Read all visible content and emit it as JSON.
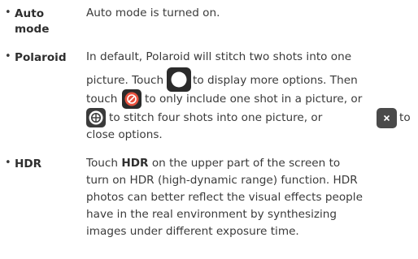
{
  "entries": [
    {
      "term_line1": "Auto",
      "term_line2": "mode",
      "desc": "Auto mode is turned on."
    },
    {
      "term": "Polaroid",
      "line1": "In default, Polaroid will stitch two shots into one",
      "line2_a": "picture. Touch",
      "line2_b": "to display more options. Then",
      "line3_a": "touch",
      "line3_b": "to only include one shot in a picture, or",
      "line4_a": "to stitch four shots into one picture, or",
      "line4_b": "to",
      "line5": "close options."
    },
    {
      "term": "HDR",
      "line1_a": "Touch",
      "line1_bold": "HDR",
      "line1_b": "on the upper part of the screen to",
      "line2": "turn on HDR (high-dynamic range) function. HDR",
      "line3": "photos can better reflect the visual effects people",
      "line4": "have in the real environment by synthesizing",
      "line5": "images under different exposure time."
    }
  ],
  "icons": {
    "options": "circle-options-icon",
    "single": "single-shot-icon",
    "four": "four-shots-icon",
    "close": "close-options-icon"
  },
  "colors": {
    "text": "#3a3a3a",
    "icon_bg": "#2b2b2b",
    "single_accent": "#e8523f",
    "icon_fg": "#ffffff"
  }
}
